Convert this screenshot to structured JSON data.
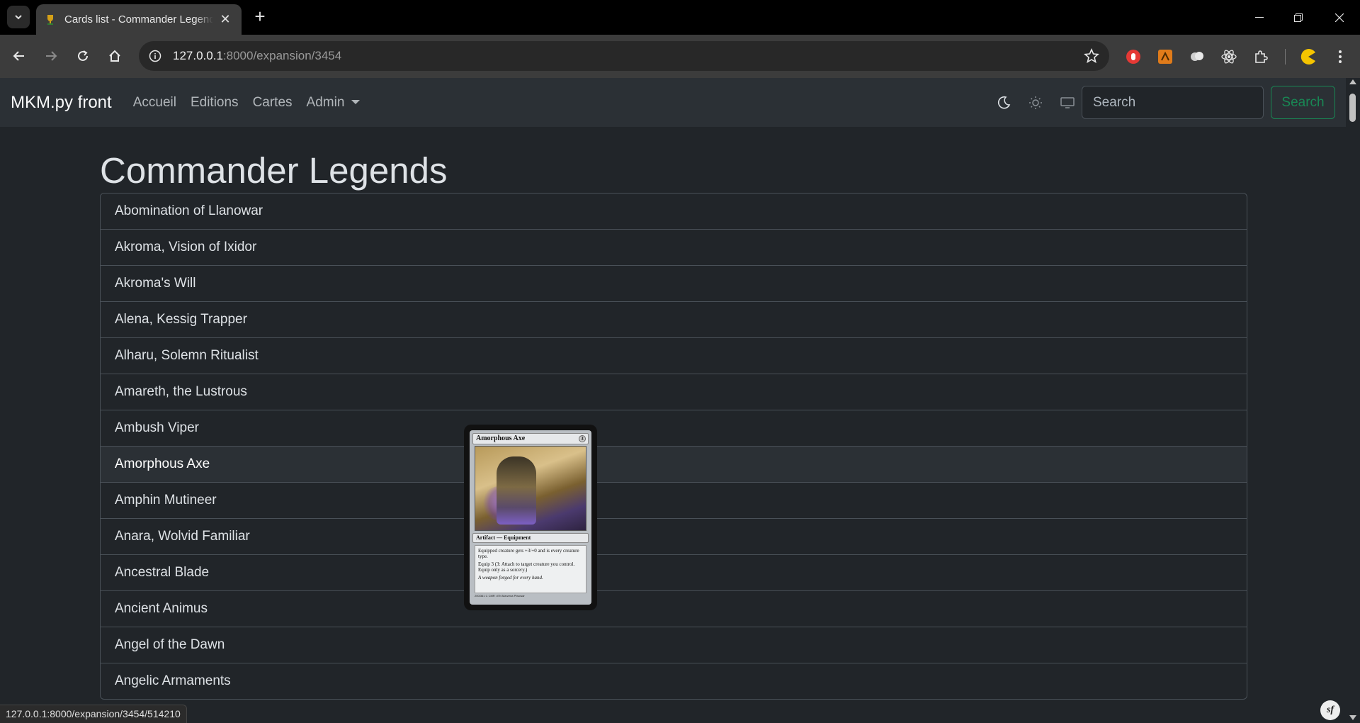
{
  "browser": {
    "tab": {
      "title": "Cards list - Commander Legends"
    },
    "url": {
      "host": "127.0.0.1",
      "rest": ":8000/expansion/3454"
    },
    "status_url": "127.0.0.1:8000/expansion/3454/514210"
  },
  "navbar": {
    "brand": "MKM.py front",
    "links": [
      {
        "label": "Accueil"
      },
      {
        "label": "Editions"
      },
      {
        "label": "Cartes"
      },
      {
        "label": "Admin"
      }
    ],
    "search": {
      "placeholder": "Search",
      "button_label": "Search"
    }
  },
  "main": {
    "title": "Commander Legends",
    "cards": [
      "Abomination of Llanowar",
      "Akroma, Vision of Ixidor",
      "Akroma's Will",
      "Alena, Kessig Trapper",
      "Alharu, Solemn Ritualist",
      "Amareth, the Lustrous",
      "Ambush Viper",
      "Amorphous Axe",
      "Amphin Mutineer",
      "Anara, Wolvid Familiar",
      "Ancestral Blade",
      "Ancient Animus",
      "Angel of the Dawn",
      "Angelic Armaments"
    ],
    "hovered_index": 7
  },
  "card_preview": {
    "name": "Amorphous Axe",
    "cost": "3",
    "type_line": "Artifact — Equipment",
    "rules": [
      "Equipped creature gets +3/+0 and is every creature type.",
      "Equip 3 (3: Attach to target creature you control. Equip only as a sorcery.)"
    ],
    "flavor": "A weapon forged for every hand.",
    "footer": "200/361 C  CMR • EN  Marzena Piwowar"
  },
  "colors": {
    "page_bg": "#212529",
    "navbar_bg": "#2b3035",
    "search_button": "#198754"
  }
}
